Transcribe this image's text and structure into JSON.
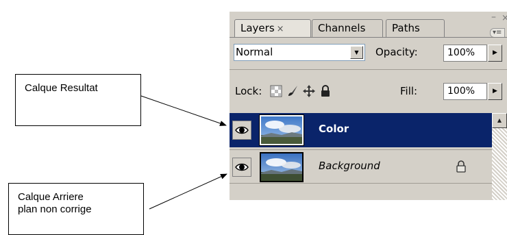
{
  "callouts": {
    "result": "Calque Resultat",
    "background_line1": "Calque Arriere",
    "background_line2": "plan non corrige"
  },
  "panel": {
    "tabs": [
      {
        "label": "Layers",
        "close": "×",
        "active": true
      },
      {
        "label": "Channels",
        "active": false
      },
      {
        "label": "Paths",
        "active": false
      }
    ],
    "minimize_glyph": "–",
    "close_glyph": "×",
    "menu_glyph": "▾≡",
    "blend_mode": "Normal",
    "opacity_label": "Opacity:",
    "opacity_value": "100%",
    "lock_label": "Lock:",
    "fill_label": "Fill:",
    "fill_value": "100%",
    "lock_icons": [
      "lock-transparent-icon",
      "lock-brush-icon",
      "lock-move-icon",
      "lock-all-icon"
    ],
    "layers": [
      {
        "name": "Color",
        "selected": true,
        "visible": true
      },
      {
        "name": "Background",
        "selected": false,
        "visible": true,
        "locked": true
      }
    ]
  },
  "colors": {
    "panel_bg": "#d4d0c8",
    "selection": "#0a246a"
  }
}
